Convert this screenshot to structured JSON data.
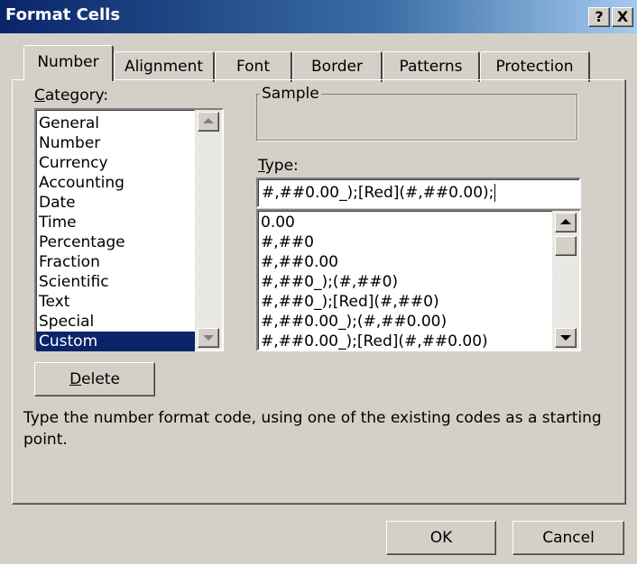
{
  "window": {
    "title": "Format Cells",
    "help_button": "?",
    "close_button": "X"
  },
  "tabs": [
    {
      "label": "Number",
      "active": true
    },
    {
      "label": "Alignment",
      "active": false
    },
    {
      "label": "Font",
      "active": false
    },
    {
      "label": "Border",
      "active": false
    },
    {
      "label": "Patterns",
      "active": false
    },
    {
      "label": "Protection",
      "active": false
    }
  ],
  "category": {
    "label_accel": "C",
    "label_rest": "ategory:",
    "items": [
      "General",
      "Number",
      "Currency",
      "Accounting",
      "Date",
      "Time",
      "Percentage",
      "Fraction",
      "Scientific",
      "Text",
      "Special",
      "Custom"
    ],
    "selected": "Custom"
  },
  "sample": {
    "label": "Sample",
    "value": ""
  },
  "type": {
    "label_accel": "T",
    "label_rest": "ype:",
    "value": "#,##0.00_);[Red](#,##0.00);",
    "options": [
      "0.00",
      "#,##0",
      "#,##0.00",
      "#,##0_);(#,##0)",
      "#,##0_);[Red](#,##0)",
      "#,##0.00_);(#,##0.00)",
      "#,##0.00_);[Red](#,##0.00)"
    ]
  },
  "delete_button": {
    "accel": "D",
    "rest": "elete"
  },
  "hint": "Type the number format code, using one of the existing codes as a starting point.",
  "buttons": {
    "ok": "OK",
    "cancel": "Cancel"
  },
  "colors": {
    "selection": "#0a246a",
    "face": "#d4d0c8"
  }
}
